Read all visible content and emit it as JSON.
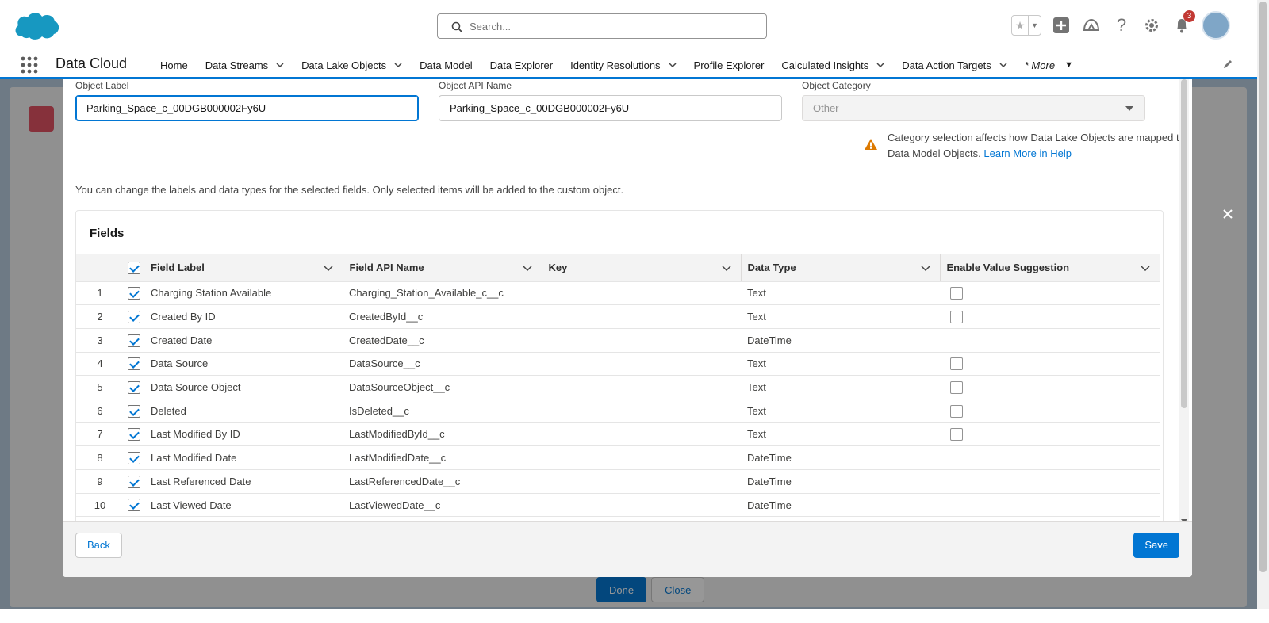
{
  "header": {
    "search_placeholder": "Search...",
    "notification_count": "3"
  },
  "nav": {
    "app_name": "Data Cloud",
    "items": [
      {
        "label": "Home",
        "chevron": false
      },
      {
        "label": "Data Streams",
        "chevron": true
      },
      {
        "label": "Data Lake Objects",
        "chevron": true
      },
      {
        "label": "Data Model",
        "chevron": false
      },
      {
        "label": "Data Explorer",
        "chevron": false
      },
      {
        "label": "Identity Resolutions",
        "chevron": true
      },
      {
        "label": "Profile Explorer",
        "chevron": false
      },
      {
        "label": "Calculated Insights",
        "chevron": true
      },
      {
        "label": "Data Action Targets",
        "chevron": true
      }
    ],
    "more_label": "* More"
  },
  "background": {
    "done_label": "Done",
    "close_label": "Close"
  },
  "form": {
    "object_label": {
      "label": "Object Label",
      "value": "Parking_Space_c_00DGB000002Fy6U"
    },
    "object_api_name": {
      "label": "Object API Name",
      "value": "Parking_Space_c_00DGB000002Fy6U"
    },
    "object_category": {
      "label": "Object Category",
      "value": "Other"
    },
    "warning_text": "Category selection affects how Data Lake Objects are mapped to Data Model Objects.",
    "warning_link": "Learn More in Help",
    "intro": "You can change the labels and data types for the selected fields. Only selected items will be added to the custom object."
  },
  "fields": {
    "title": "Fields",
    "columns": [
      "Field Label",
      "Field API Name",
      "Key",
      "Data Type",
      "Enable Value Suggestion"
    ],
    "rows": [
      {
        "num": "1",
        "label": "Charging Station Available",
        "api": "Charging_Station_Available_c__c",
        "key": "",
        "type": "Text",
        "suggest": true
      },
      {
        "num": "2",
        "label": "Created By ID",
        "api": "CreatedById__c",
        "key": "",
        "type": "Text",
        "suggest": true
      },
      {
        "num": "3",
        "label": "Created Date",
        "api": "CreatedDate__c",
        "key": "",
        "type": "DateTime",
        "suggest": false
      },
      {
        "num": "4",
        "label": "Data Source",
        "api": "DataSource__c",
        "key": "",
        "type": "Text",
        "suggest": true
      },
      {
        "num": "5",
        "label": "Data Source Object",
        "api": "DataSourceObject__c",
        "key": "",
        "type": "Text",
        "suggest": true
      },
      {
        "num": "6",
        "label": "Deleted",
        "api": "IsDeleted__c",
        "key": "",
        "type": "Text",
        "suggest": true
      },
      {
        "num": "7",
        "label": "Last Modified By ID",
        "api": "LastModifiedById__c",
        "key": "",
        "type": "Text",
        "suggest": true
      },
      {
        "num": "8",
        "label": "Last Modified Date",
        "api": "LastModifiedDate__c",
        "key": "",
        "type": "DateTime",
        "suggest": false
      },
      {
        "num": "9",
        "label": "Last Referenced Date",
        "api": "LastReferencedDate__c",
        "key": "",
        "type": "DateTime",
        "suggest": false
      },
      {
        "num": "10",
        "label": "Last Viewed Date",
        "api": "LastViewedDate__c",
        "key": "",
        "type": "DateTime",
        "suggest": false
      }
    ]
  },
  "footer": {
    "back_label": "Back",
    "save_label": "Save"
  },
  "colors": {
    "brand": "#0176d3",
    "warning": "#dd7a01"
  }
}
